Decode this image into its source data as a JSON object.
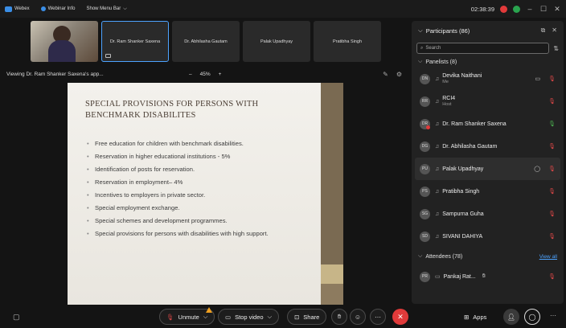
{
  "titlebar": {
    "app_name": "Webex",
    "webinar_info": "Webinar Info",
    "menu_bar": "Show Menu Bar",
    "time": "02:38:39",
    "min": "–",
    "max": "☐",
    "close": "✕"
  },
  "tiles": [
    {
      "name": ""
    },
    {
      "name": "Dr. Ram Shanker Saxena"
    },
    {
      "name": "Dr. Abhilasha Gautam"
    },
    {
      "name": "Palak Upadhyay"
    },
    {
      "name": "Pratibha Singh"
    }
  ],
  "viewbar": {
    "viewing": "Viewing Dr. Ram Shanker Saxena's app...",
    "zoom_minus": "–",
    "zoom": "45%",
    "zoom_plus": "+"
  },
  "slide": {
    "title": "Special Provisions for Persons with Benchmark Disabilites",
    "bullets": [
      "Free education for children with benchmark disabilities.",
      "Reservation in higher educational institutions - 5%",
      "Identification of posts for reservation.",
      "Reservation in employment– 4%",
      "Incentives to employers in private sector.",
      "Special employment exchange.",
      "Special schemes and development programmes.",
      "Special provisions for persons with disabilities with high support."
    ]
  },
  "participants": {
    "header": "Participants (86)",
    "search_placeholder": "Search",
    "panelists_label": "Panelists (8)",
    "panelists": [
      {
        "initials": "DN",
        "name": "Devika Naithani",
        "sub": "Me"
      },
      {
        "initials": "RR",
        "name": "RCI4",
        "sub": "Host"
      },
      {
        "initials": "DR",
        "name": "Dr. Ram Shanker Saxena",
        "sub": ""
      },
      {
        "initials": "DG",
        "name": "Dr. Abhilasha Gautam",
        "sub": ""
      },
      {
        "initials": "PU",
        "name": "Palak Upadhyay",
        "sub": ""
      },
      {
        "initials": "PS",
        "name": "Pratibha Singh",
        "sub": ""
      },
      {
        "initials": "SG",
        "name": "Sampurna Guha",
        "sub": ""
      },
      {
        "initials": "SD",
        "name": "SIVANI DAHIYA",
        "sub": ""
      }
    ],
    "attendees_label": "Attendees (78)",
    "view_all": "View all",
    "attendees": [
      {
        "initials": "PR",
        "name": "Pankaj Rat..."
      }
    ]
  },
  "toolbar": {
    "unmute": "Unmute",
    "stop_video": "Stop video",
    "share": "Share",
    "apps": "Apps"
  }
}
